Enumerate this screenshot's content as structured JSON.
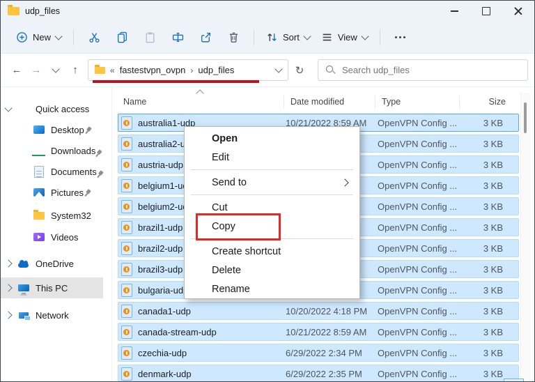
{
  "window": {
    "title": "udp_files"
  },
  "toolbar": {
    "new": "New",
    "sort": "Sort",
    "view": "View"
  },
  "nav": {
    "glyphs": {
      "back": "←",
      "forward": "→",
      "up": "↑",
      "refresh": "↻"
    }
  },
  "breadcrumb": {
    "overflow": "«",
    "separator": "›",
    "items": [
      "fastestvpn_ovpn",
      "udp_files"
    ]
  },
  "search": {
    "placeholder": "Search udp_files"
  },
  "sidebar": {
    "items": [
      {
        "label": "Quick access",
        "icon": "star-icon",
        "expander": "v"
      },
      {
        "label": "Desktop",
        "icon": "desktop-icon",
        "indent": 1,
        "pinned": true
      },
      {
        "label": "Downloads",
        "icon": "downloads-icon",
        "indent": 1,
        "pinned": true
      },
      {
        "label": "Documents",
        "icon": "documents-icon",
        "indent": 1,
        "pinned": true
      },
      {
        "label": "Pictures",
        "icon": "pictures-icon",
        "indent": 1,
        "pinned": true
      },
      {
        "label": "System32",
        "icon": "folder-icon",
        "indent": 1,
        "extra_gap": 3
      },
      {
        "label": "Videos",
        "icon": "videos-icon",
        "indent": 1,
        "extra_gap": 1
      },
      {
        "label": "OneDrive",
        "icon": "onedrive-icon",
        "expander": ">",
        "extra_gap": 8
      },
      {
        "label": "This PC",
        "icon": "thispc-icon",
        "expander": ">",
        "selected": true,
        "extra_gap": 5
      },
      {
        "label": "Network",
        "icon": "network-icon",
        "expander": ">",
        "extra_gap": 9
      }
    ]
  },
  "list": {
    "columns": [
      "Name",
      "Date modified",
      "Type",
      "Size"
    ],
    "rows": [
      {
        "name": "australia1-udp",
        "date": "10/21/2022 8:59 AM",
        "type": "OpenVPN Config ...",
        "size": "3 KB"
      },
      {
        "name": "australia2-udp",
        "date": "",
        "type": "OpenVPN Config ...",
        "size": "3 KB"
      },
      {
        "name": "austria-udp",
        "date": "",
        "type": "OpenVPN Config ...",
        "size": "3 KB"
      },
      {
        "name": "belgium1-udp",
        "date": "",
        "type": "OpenVPN Config ...",
        "size": "3 KB"
      },
      {
        "name": "belgium2-udp",
        "date": "",
        "type": "OpenVPN Config ...",
        "size": "3 KB"
      },
      {
        "name": "brazil1-udp",
        "date": "",
        "type": "OpenVPN Config ...",
        "size": "3 KB"
      },
      {
        "name": "brazil2-udp",
        "date": "",
        "type": "OpenVPN Config ...",
        "size": "3 KB"
      },
      {
        "name": "brazil3-udp",
        "date": "",
        "type": "OpenVPN Config ...",
        "size": "3 KB"
      },
      {
        "name": "bulgaria-udp",
        "date": "",
        "type": "OpenVPN Config ...",
        "size": "3 KB"
      },
      {
        "name": "canada1-udp",
        "date": "10/20/2022 4:18 PM",
        "type": "OpenVPN Config ...",
        "size": "3 KB"
      },
      {
        "name": "canada-stream-udp",
        "date": "10/21/2022 8:59 AM",
        "type": "OpenVPN Config ...",
        "size": "3 KB"
      },
      {
        "name": "czechia-udp",
        "date": "6/29/2022 2:34 PM",
        "type": "OpenVPN Config ...",
        "size": "3 KB"
      },
      {
        "name": "denmark-udp",
        "date": "6/29/2022 2:35 PM",
        "type": "OpenVPN Config ...",
        "size": "3 KB"
      }
    ]
  },
  "context_menu": {
    "items": [
      {
        "label": "Open",
        "bold": true
      },
      {
        "label": "Edit"
      },
      {
        "separator": true
      },
      {
        "label": "Send to",
        "submenu": true
      },
      {
        "separator": true
      },
      {
        "label": "Cut"
      },
      {
        "label": "Copy",
        "annotated": true
      },
      {
        "separator": true
      },
      {
        "label": "Create shortcut"
      },
      {
        "label": "Delete"
      },
      {
        "label": "Rename"
      }
    ]
  },
  "annotations": {
    "underline_color": "#c3121f",
    "copy_box_color": "#e12a28"
  },
  "colors": {
    "selection_fill": "#cde8ff",
    "selection_border": "#b5dcf8",
    "accent": "#1b72c4"
  }
}
